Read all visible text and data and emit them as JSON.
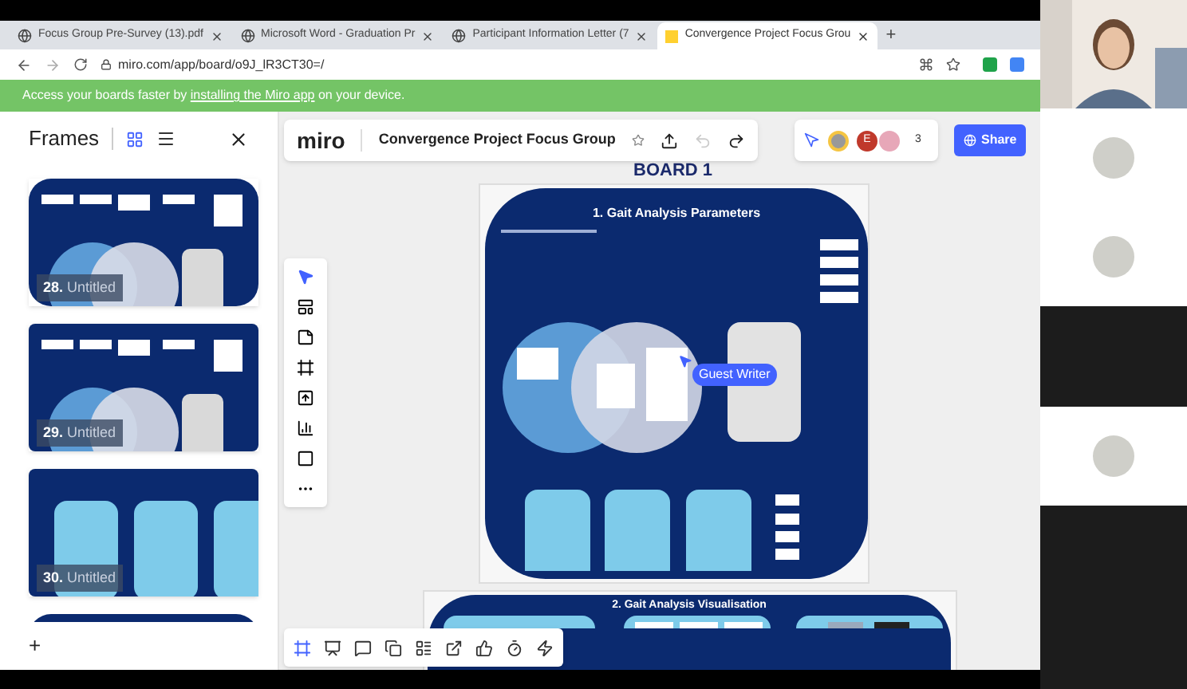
{
  "browser": {
    "tabs": [
      {
        "title": "Focus Group Pre-Survey (13).pdf",
        "selected": false
      },
      {
        "title": "Microsoft Word - Graduation Pr",
        "selected": false
      },
      {
        "title": "Participant Information Letter (7",
        "selected": false
      },
      {
        "title": "Convergence Project Focus Grou",
        "selected": true
      }
    ],
    "new_tab": "+",
    "url": "miro.com/app/board/o9J_lR3CT30=/"
  },
  "banner": {
    "text_before": "Access your boards faster by",
    "link": "installing the Miro app",
    "text_after": "on your device."
  },
  "frames_panel": {
    "title": "Frames",
    "frames": [
      {
        "number": "28.",
        "title": "Untitled",
        "kind": "venn"
      },
      {
        "number": "29.",
        "title": "Untitled",
        "kind": "venn"
      },
      {
        "number": "30.",
        "title": "Untitled",
        "kind": "columns"
      }
    ],
    "add": "+"
  },
  "board": {
    "logo": "miro",
    "title": "Convergence Project Focus Group",
    "collaborator": "E",
    "more_count": "3",
    "share": "Share",
    "canvas_label": "BOARD 1",
    "frames": [
      {
        "title": "1. Gait Analysis Parameters"
      },
      {
        "title": "2. Gait Analysis Visualisation"
      }
    ],
    "cursor_label": "Guest Writer"
  },
  "video_tiles": [
    {
      "kind": "camera"
    },
    {
      "kind": "avatar"
    },
    {
      "kind": "avatar"
    },
    {
      "kind": "empty"
    },
    {
      "kind": "avatar"
    }
  ]
}
